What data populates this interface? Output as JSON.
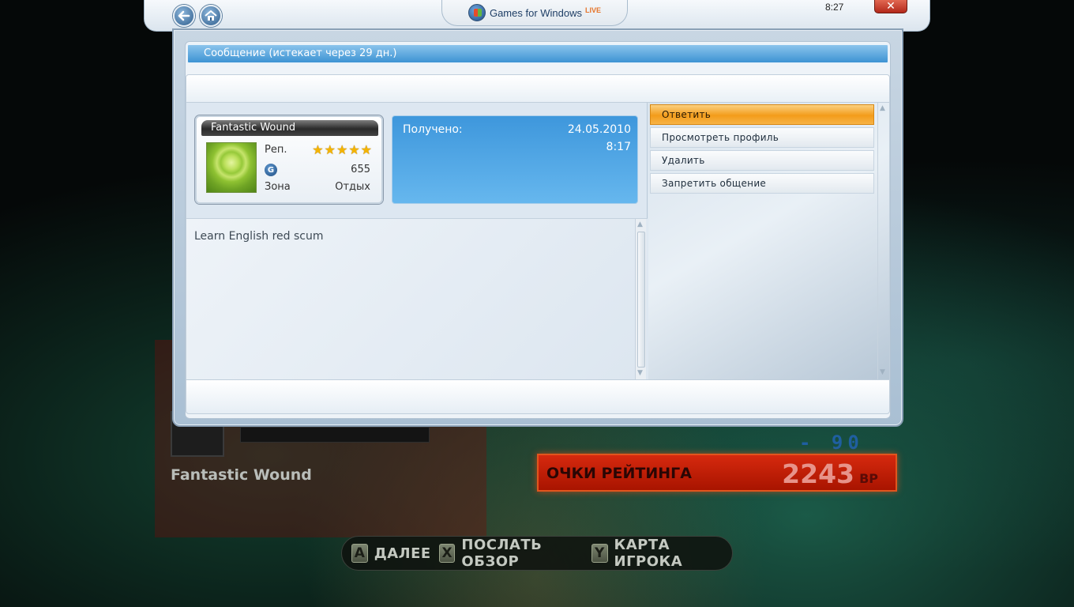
{
  "window": {
    "logo_text": "Games for Windows",
    "logo_live": "LIVE",
    "clock": "8:27",
    "close_glyph": "✕",
    "back_icon": "back-arrow-icon",
    "home_icon": "home-icon"
  },
  "dialog": {
    "title": "Сообщение (истекает через 29 дн.)",
    "gamer_card": {
      "gamertag": "Fantastic Wound",
      "rep_label": "Реп.",
      "rep_stars": 5,
      "gamerscore": "655",
      "zone_label": "Зона",
      "zone_value": "Отдых"
    },
    "received": {
      "label": "Получено:",
      "date": "24.05.2010",
      "time": "8:17"
    },
    "message_body": "Learn English red scum",
    "actions": [
      {
        "label": "Ответить",
        "selected": true
      },
      {
        "label": "Просмотреть профиль",
        "selected": false
      },
      {
        "label": "Удалить",
        "selected": false
      },
      {
        "label": "Запретить общение",
        "selected": false
      }
    ]
  },
  "background": {
    "player_name": "Fantastic Wound",
    "score_delta": "- 90",
    "rating_label": "ОЧКИ РЕЙТИНГА",
    "rating_value": "2243",
    "rating_unit": "BP",
    "hints": [
      {
        "key": "A",
        "label": "ДАЛЕЕ"
      },
      {
        "key": "X",
        "label": "ПОСЛАТЬ ОБЗОР"
      },
      {
        "key": "Y",
        "label": "КАРТА ИГРОКА"
      }
    ]
  },
  "colors": {
    "title_bar": "#3d93d3",
    "selected_action": "#f39c1a",
    "rating_panel": "#d6290e"
  }
}
